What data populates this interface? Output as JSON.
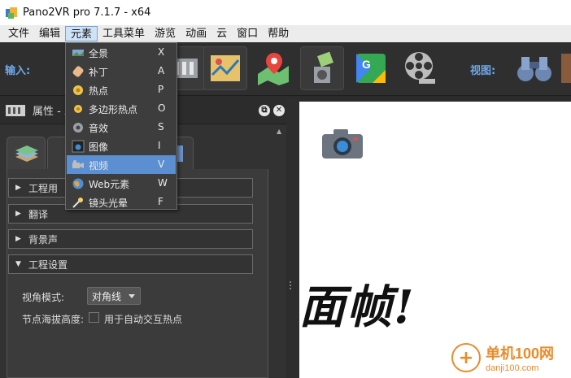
{
  "window": {
    "title": "Pano2VR pro 7.1.7 - x64"
  },
  "menubar": [
    "文件",
    "编辑",
    "元素",
    "工具菜单",
    "游览",
    "动画",
    "云",
    "窗口",
    "帮助"
  ],
  "toolbar": {
    "input_label": "输入:",
    "view_label": "视图:"
  },
  "element_menu": [
    {
      "label": "全景",
      "shortcut": "X",
      "icon": "panorama-icon"
    },
    {
      "label": "补丁",
      "shortcut": "A",
      "icon": "patch-icon"
    },
    {
      "label": "热点",
      "shortcut": "P",
      "icon": "hotspot-icon"
    },
    {
      "label": "多边形热点",
      "shortcut": "O",
      "icon": "polygon-hotspot-icon"
    },
    {
      "label": "音效",
      "shortcut": "S",
      "icon": "sound-icon"
    },
    {
      "label": "图像",
      "shortcut": "I",
      "icon": "image-icon"
    },
    {
      "label": "视频",
      "shortcut": "V",
      "icon": "video-icon",
      "selected": true
    },
    {
      "label": "Web元素",
      "shortcut": "W",
      "icon": "web-element-icon"
    },
    {
      "label": "镜头光晕",
      "shortcut": "F",
      "icon": "lens-flare-icon"
    }
  ],
  "properties": {
    "title": "属性 - 工",
    "sections": [
      "工程用",
      "翻译",
      "背景声",
      "工程设置"
    ],
    "view_mode_label": "视角模式:",
    "view_mode_value": "对角线",
    "node_altitude_label": "节点海拔高度:",
    "auto_hotspot_label": "用于自动交互热点"
  },
  "viewport": {
    "overlay_text": "面帧!"
  },
  "watermark": {
    "site_cn": "单机100网",
    "site_url": "danji100.com"
  },
  "colors": {
    "accent": "#5b8fd1",
    "label_blue": "#6ea8e8",
    "watermark": "#e98b2a"
  }
}
